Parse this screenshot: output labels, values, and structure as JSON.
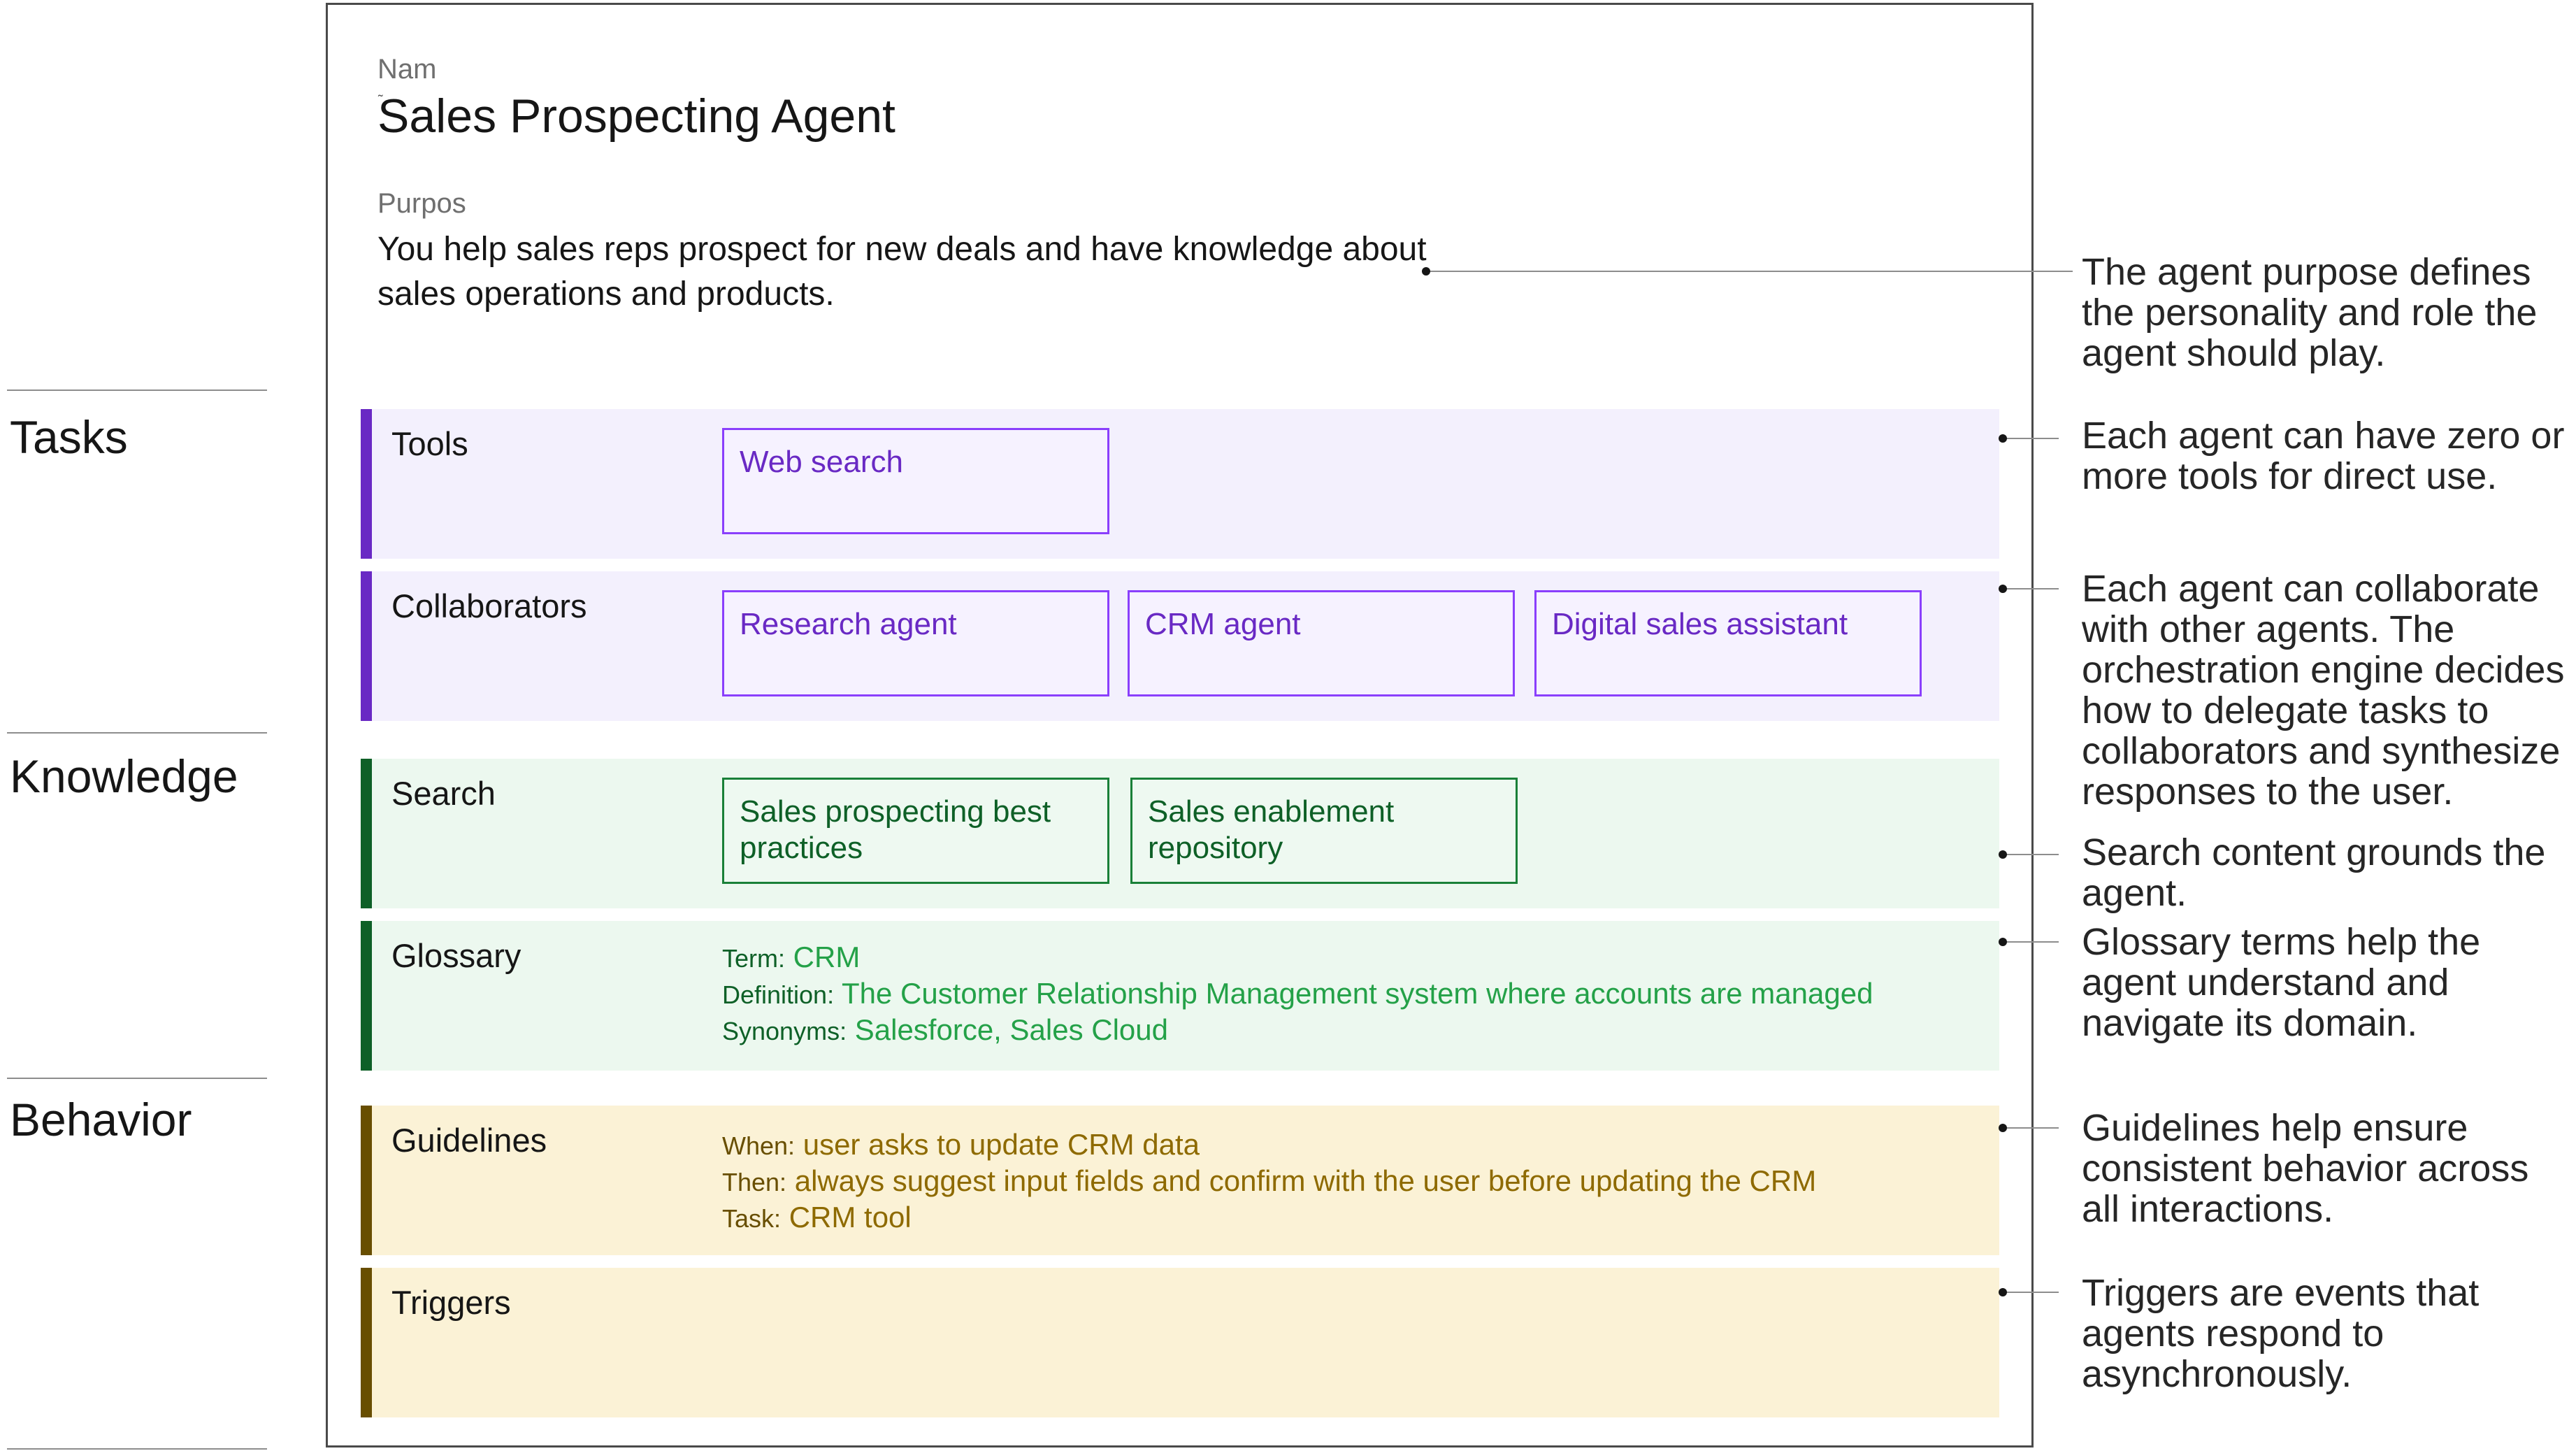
{
  "categories": {
    "tasks": "Tasks",
    "knowledge": "Knowledge",
    "behavior": "Behavior"
  },
  "agent": {
    "name_label": "Nam",
    "name": "Sales Prospecting Agent",
    "purpose_label": "Purpos",
    "purpose": "You help sales reps prospect for new deals and have knowledge about sales operations and products."
  },
  "tools": {
    "title": "Tools",
    "items": [
      "Web search"
    ]
  },
  "collaborators": {
    "title": "Collaborators",
    "items": [
      "Research agent",
      "CRM agent",
      "Digital sales assistant"
    ]
  },
  "search": {
    "title": "Search",
    "items": [
      "Sales prospecting best practices",
      "Sales enablement repository"
    ]
  },
  "glossary": {
    "title": "Glossary",
    "term_key": "Term:",
    "term": "CRM",
    "definition_key": "Definition:",
    "definition": "The Customer Relationship Management system where accounts are managed",
    "synonyms_key": "Synonyms:",
    "synonyms": "Salesforce, Sales Cloud"
  },
  "guidelines": {
    "title": "Guidelines",
    "when_key": "When:",
    "when": "user asks to update CRM data",
    "then_key": "Then:",
    "then": "always suggest input fields and confirm with the user before updating the CRM",
    "task_key": "Task:",
    "task": "CRM tool"
  },
  "triggers": {
    "title": "Triggers"
  },
  "annotations": {
    "purpose": "The agent purpose defines the personality and role the agent should play.",
    "tools": "Each agent can have zero or more tools for direct use.",
    "collaborators": "Each agent can collaborate with other agents. The orchestration engine decides how to delegate tasks to collaborators and synthesize responses to the user.",
    "search": "Search content grounds the agent.",
    "glossary": "Glossary terms help the agent understand and navigate its domain.",
    "guidelines": "Guidelines help ensure consistent behavior across all interactions.",
    "triggers": "Triggers are events that agents respond to asynchronously."
  },
  "colors": {
    "tasks_accent": "#6929c4",
    "knowledge_accent": "#0e6027",
    "behavior_accent": "#684e00",
    "tasks_fill": "#f3f0fd",
    "knowledge_fill": "#ecf8ef",
    "behavior_fill": "#fbf2d6"
  }
}
